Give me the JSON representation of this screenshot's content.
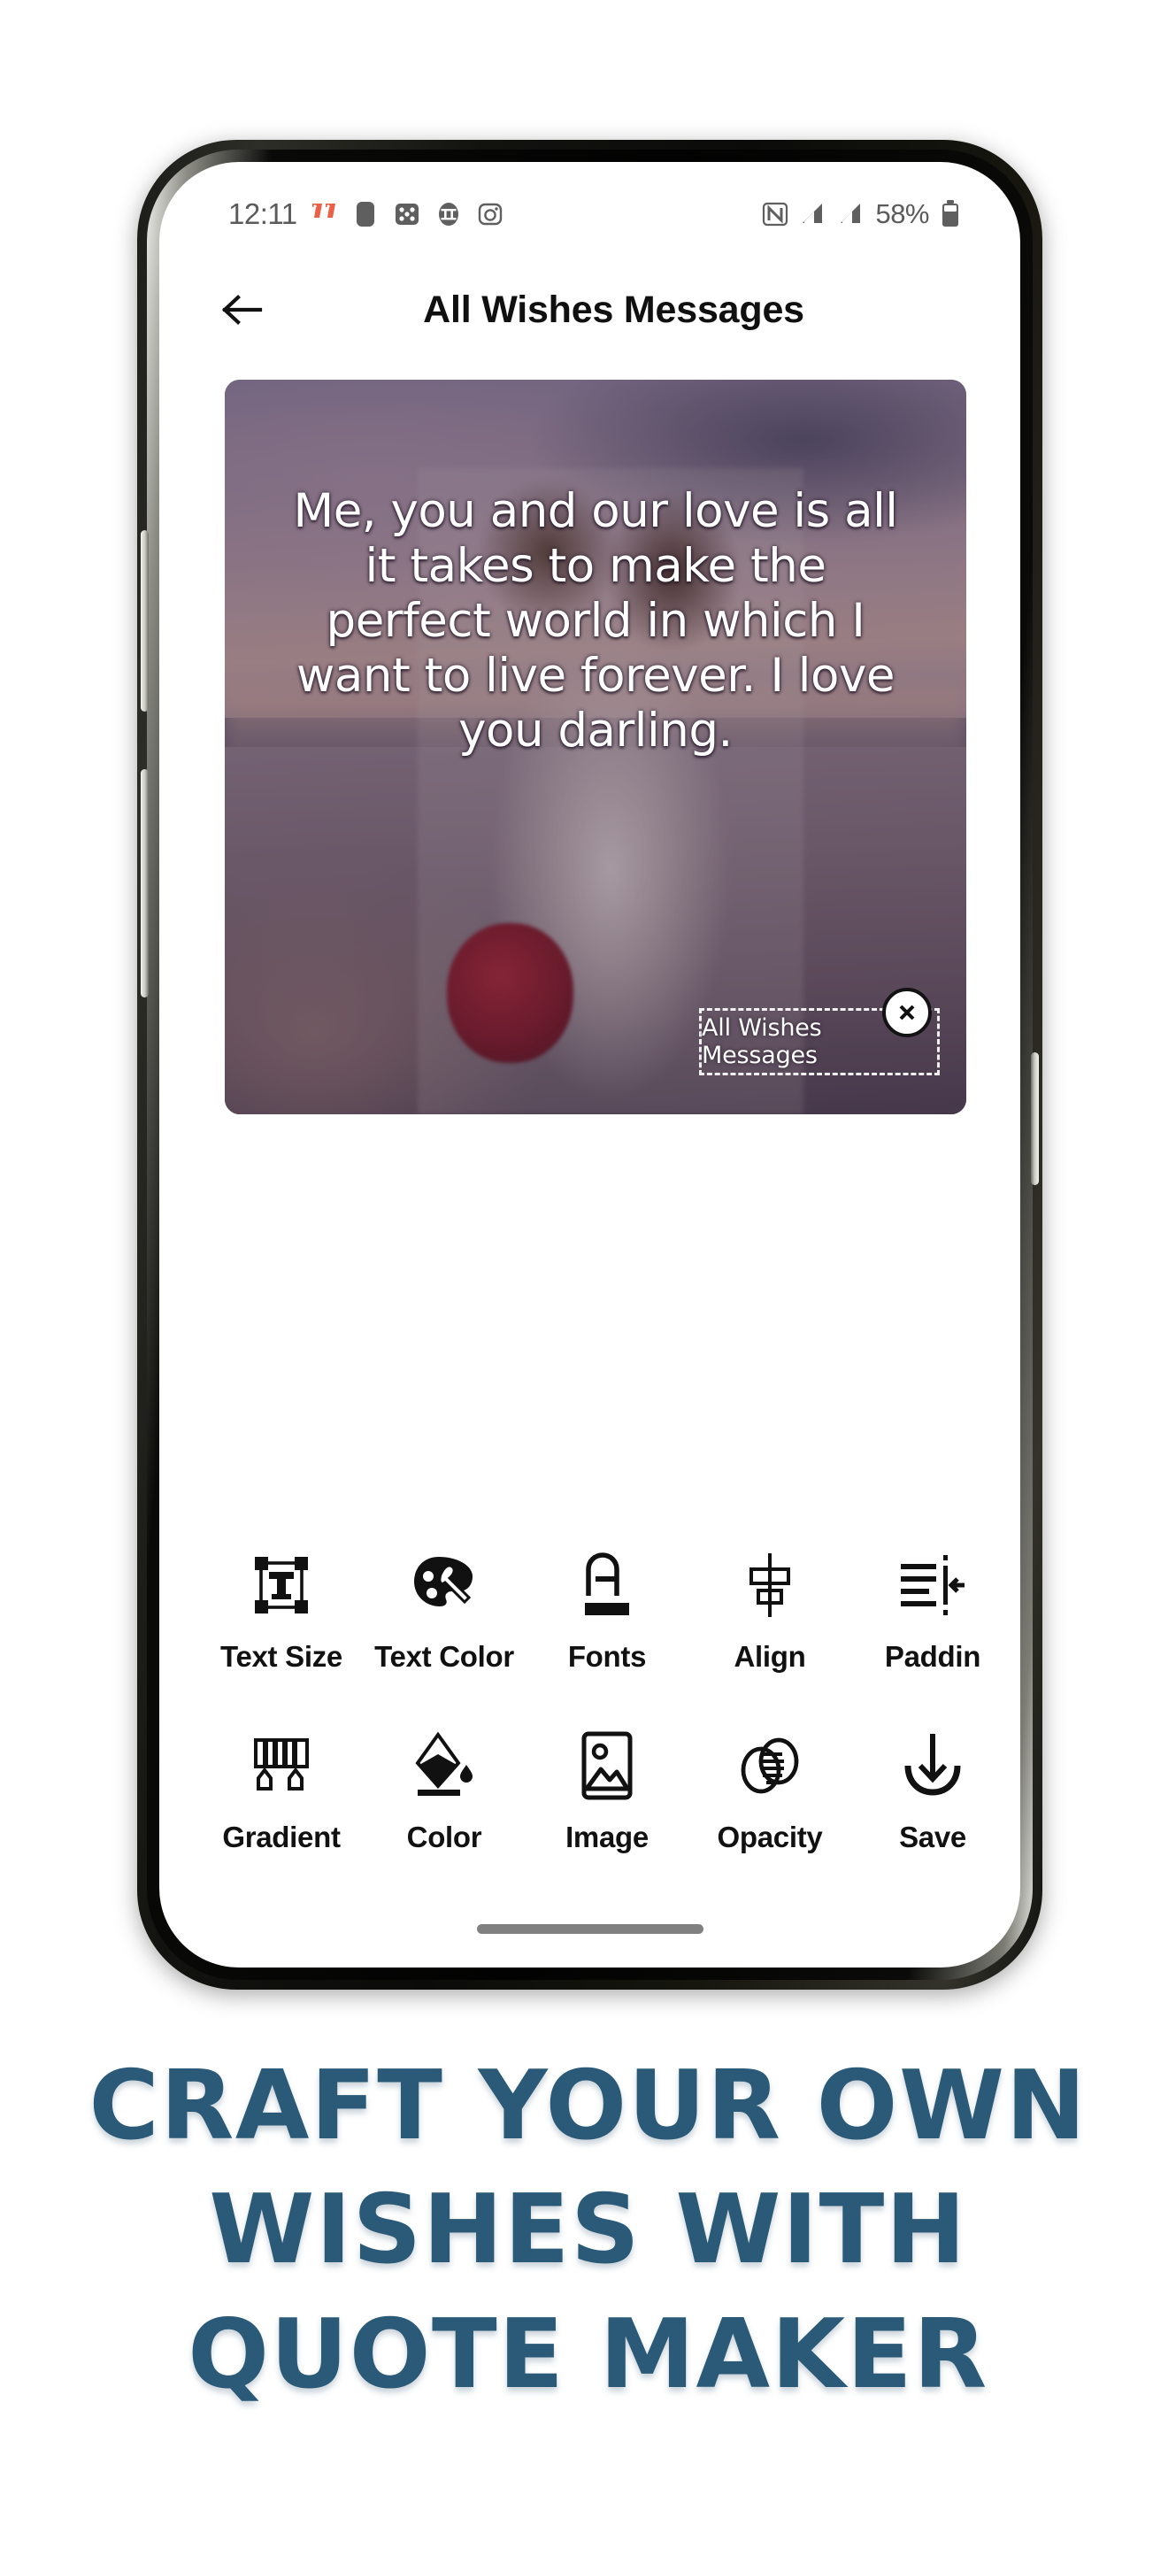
{
  "status_bar": {
    "time": "12:11",
    "battery_percent": "58%",
    "left_icons": [
      "quote-marks-icon",
      "rounded-square-icon",
      "dice-icon",
      "circled-tt-icon",
      "camera-icon"
    ],
    "right_icons": [
      "nfc-icon",
      "signal-bars-icon",
      "signal-bars-icon-2",
      "battery-icon"
    ],
    "accent_color": "#ec6047",
    "text_color": "#5b5b5b"
  },
  "header": {
    "back_icon": "arrow-left-icon",
    "title": "All Wishes Messages"
  },
  "card": {
    "quote_lines": [
      "Me, you and our love is all",
      "it takes to make the",
      "perfect world in which I",
      "want to live forever. I love",
      "you darling."
    ],
    "watermark": {
      "text": "All Wishes Messages",
      "close_icon": "close-icon"
    }
  },
  "toolbar": {
    "rows": [
      [
        {
          "label": "Text Size",
          "icon": "text-size-icon"
        },
        {
          "label": "Text Color",
          "icon": "palette-icon"
        },
        {
          "label": "Fonts",
          "icon": "fonts-icon"
        },
        {
          "label": "Align",
          "icon": "align-icon"
        },
        {
          "label": "Paddin",
          "icon": "padding-icon"
        }
      ],
      [
        {
          "label": "Gradient",
          "icon": "gradient-icon"
        },
        {
          "label": "Color",
          "icon": "paint-bucket-icon"
        },
        {
          "label": "Image",
          "icon": "image-icon"
        },
        {
          "label": "Opacity",
          "icon": "opacity-icon"
        },
        {
          "label": "Save",
          "icon": "download-icon"
        }
      ]
    ]
  },
  "nav": {
    "pill": "home-gesture-pill"
  },
  "caption": {
    "line1": "Craft Your Own",
    "line2": "Wishes With",
    "line3": "Quote Maker",
    "color": "#2b5a78"
  }
}
